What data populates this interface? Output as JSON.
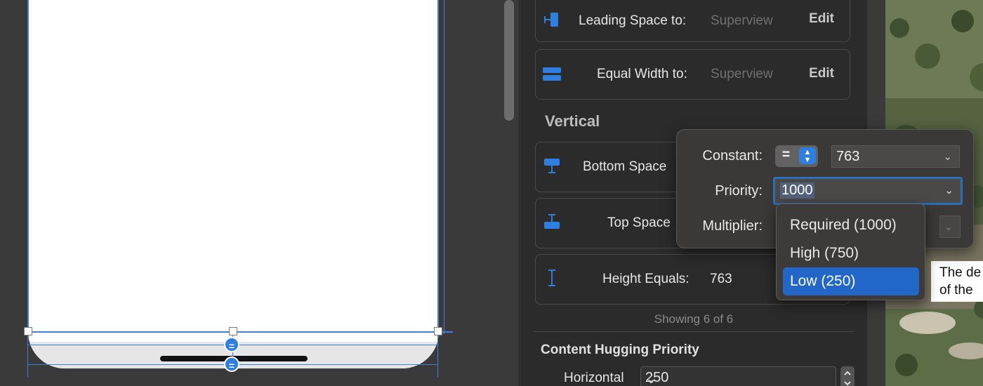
{
  "inspector": {
    "rows": [
      {
        "label": "Leading Space to:",
        "target": "Superview",
        "edit": "Edit"
      },
      {
        "label": "Equal Width to:",
        "target": "Superview",
        "edit": "Edit"
      },
      {
        "label": "Bottom Space"
      },
      {
        "label": "Top Space"
      },
      {
        "label": "Height Equals:",
        "target": "763"
      }
    ],
    "vertical_title": "Vertical",
    "showing": "Showing 6 of 6",
    "content_hugging_title": "Content Hugging Priority",
    "horizontal_label": "Horizontal",
    "horizontal_value": "250"
  },
  "popover": {
    "constant_label": "Constant:",
    "relation": "=",
    "constant_value": "763",
    "priority_label": "Priority:",
    "priority_value": "1000",
    "multiplier_label": "Multiplier:"
  },
  "priority_menu": {
    "items": [
      "Required (1000)",
      "High (750)",
      "Low (250)"
    ],
    "selected_index": 2
  },
  "canvas": {
    "badge_top": "=",
    "badge_bottom": "="
  },
  "tooltip": {
    "line1": "The de",
    "line2": "of the"
  },
  "colors": {
    "accent": "#2f7fe0",
    "selection": "#2267c8",
    "constraint_line": "#3f7fd8"
  }
}
